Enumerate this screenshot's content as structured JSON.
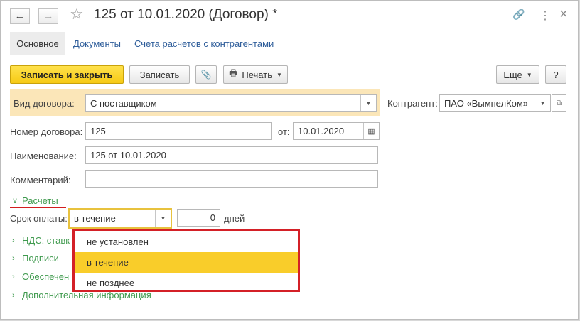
{
  "window": {
    "title": "125 от 10.01.2020 (Договор) *",
    "back_icon": "←",
    "forward_icon": "→",
    "star_icon": "☆",
    "link_icon": "🔗",
    "more_icon": "⋮",
    "close_icon": "×"
  },
  "tabs": {
    "main": "Основное",
    "documents": "Документы",
    "accounts": "Счета расчетов с контрагентами"
  },
  "toolbar": {
    "save_close": "Записать и закрыть",
    "save": "Записать",
    "attach_icon": "📎",
    "print_icon": "🖶",
    "print": "Печать",
    "more": "Еще",
    "help": "?"
  },
  "form": {
    "contract_type_label": "Вид договора:",
    "contract_type_value": "С поставщиком",
    "counterparty_label": "Контрагент:",
    "counterparty_value": "ПАО «ВымпелКом»",
    "number_label": "Номер договора:",
    "number_value": "125",
    "date_label": "от:",
    "date_value": "10.01.2020",
    "name_label": "Наименование:",
    "name_value": "125 от 10.01.2020",
    "comment_label": "Комментарий:",
    "comment_value": ""
  },
  "settlements": {
    "header": "Расчеты",
    "payment_term_label": "Срок оплаты:",
    "payment_term_value": "в течение",
    "days_value": "0",
    "days_label": "дней"
  },
  "dropdown": {
    "options": [
      "не установлен",
      "в течение",
      "не позднее"
    ],
    "selected_index": 1
  },
  "groups": {
    "vat": "НДС: ставк",
    "signatures": "Подписи",
    "security": "Обеспечен",
    "additional": "Дополнительная информация"
  },
  "colors": {
    "primary_button": "#f6c914",
    "link": "#2e5d9a",
    "group_green": "#3f9a4e",
    "highlight_red": "#d42027",
    "selected_option": "#f9cd2a"
  }
}
